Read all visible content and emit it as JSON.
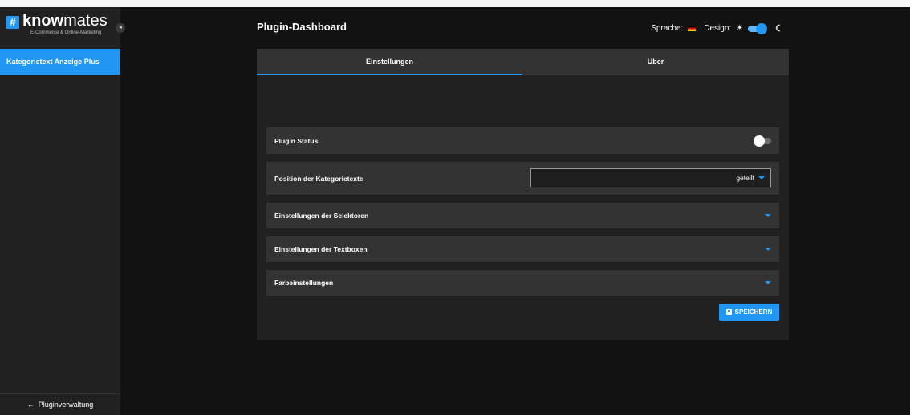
{
  "sidebar": {
    "logo": {
      "hash": "#",
      "bold": "know",
      "light": "mates",
      "tagline": "E-Commerce & Online-Marketing"
    },
    "collapse_icon": "chevron-left-icon",
    "items": [
      {
        "label": "Kategorietext Anzeige Plus",
        "active": true
      }
    ],
    "back_label": "Pluginverwaltung",
    "back_arrow": "←"
  },
  "header": {
    "title": "Plugin-Dashboard",
    "language_label": "Sprache:",
    "design_label": "Design:",
    "sun_icon": "☀",
    "moon_icon": "☾",
    "design_toggle_on": true
  },
  "tabs": [
    {
      "label": "Einstellungen",
      "active": true
    },
    {
      "label": "Über",
      "active": false
    }
  ],
  "settings": {
    "plugin_status": {
      "label": "Plugin Status",
      "enabled": false
    },
    "position": {
      "label": "Position der Kategorietexte",
      "value": "geteilt"
    },
    "sections": [
      {
        "label": "Einstellungen der Selektoren"
      },
      {
        "label": "Einstellungen der Textboxen"
      },
      {
        "label": "Farbeinstellungen"
      }
    ],
    "save_label": "SPEICHERN"
  },
  "colors": {
    "accent": "#2196f3",
    "background": "#121212",
    "surface": "#212121",
    "row": "#333333"
  }
}
